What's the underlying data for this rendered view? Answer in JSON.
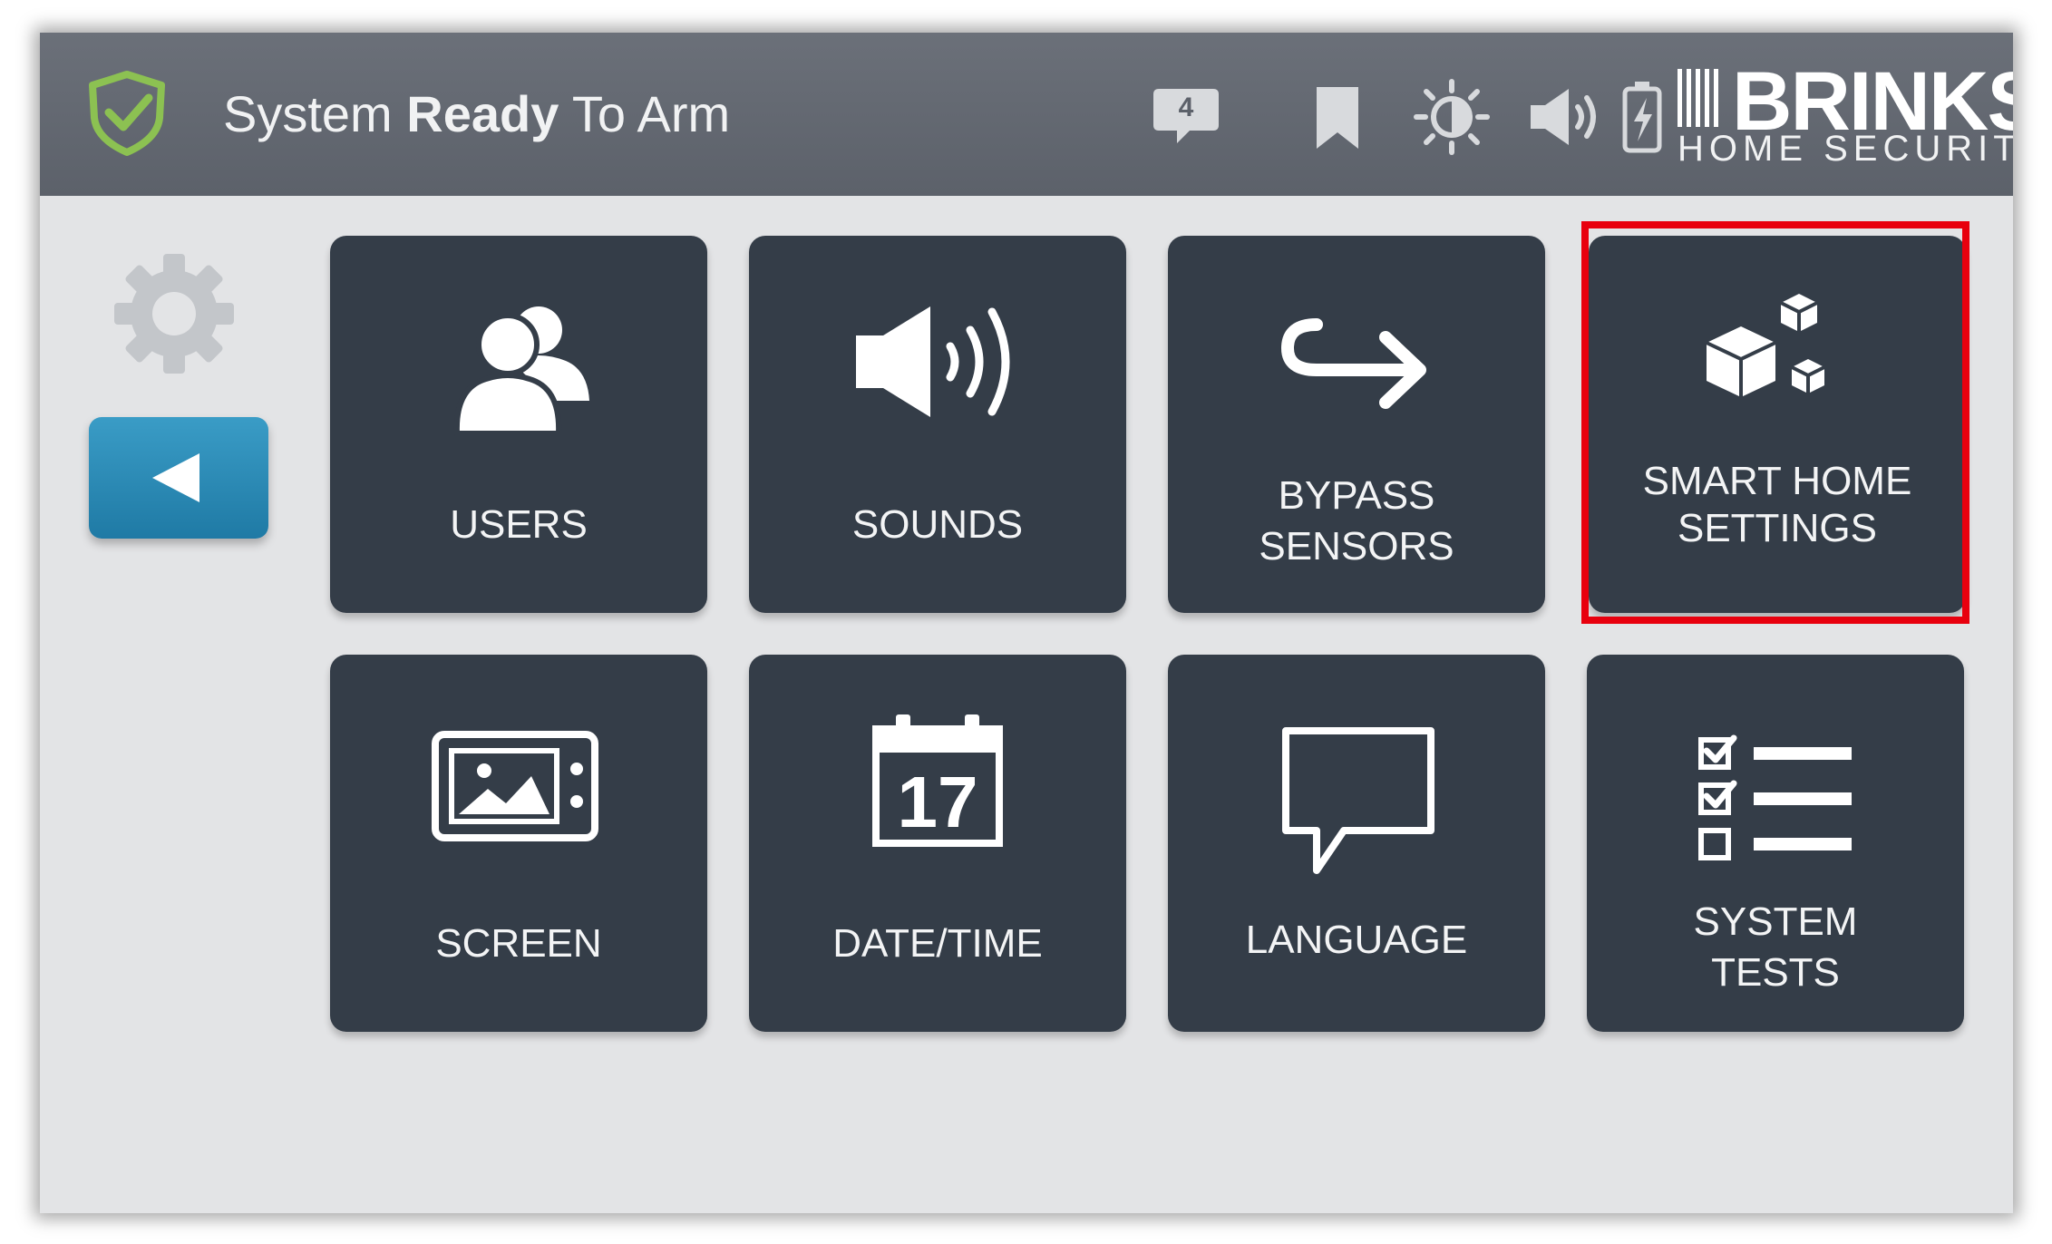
{
  "status": {
    "prefix": "System ",
    "bold": "Ready",
    "suffix": " To Arm"
  },
  "header": {
    "notification_count": "4"
  },
  "brand": {
    "name": "BRINKS",
    "tagline": "HOME SECURITY"
  },
  "tiles": [
    {
      "line1": "USERS",
      "line2": ""
    },
    {
      "line1": "SOUNDS",
      "line2": ""
    },
    {
      "line1": "BYPASS",
      "line2": "SENSORS"
    },
    {
      "line1": "SMART HOME",
      "line2": "SETTINGS"
    },
    {
      "line1": "SCREEN",
      "line2": ""
    },
    {
      "line1": "DATE/TIME",
      "line2": ""
    },
    {
      "line1": "LANGUAGE",
      "line2": ""
    },
    {
      "line1": "SYSTEM",
      "line2": "TESTS"
    }
  ],
  "calendar_day": "17",
  "icons": {
    "status": "shield-check-icon",
    "notifications": "chat-bubble-icon",
    "bookmark": "bookmark-icon",
    "brightness": "brightness-icon",
    "volume": "volume-icon",
    "battery": "battery-charging-icon",
    "settings": "gear-icon",
    "back": "back-arrow-icon"
  },
  "colors": {
    "header": "#5c616a",
    "tile": "#343d48",
    "background": "#e3e4e6",
    "back_button": "#2a8ab5",
    "shield": "#8cc152",
    "highlight": "#e8000e"
  }
}
